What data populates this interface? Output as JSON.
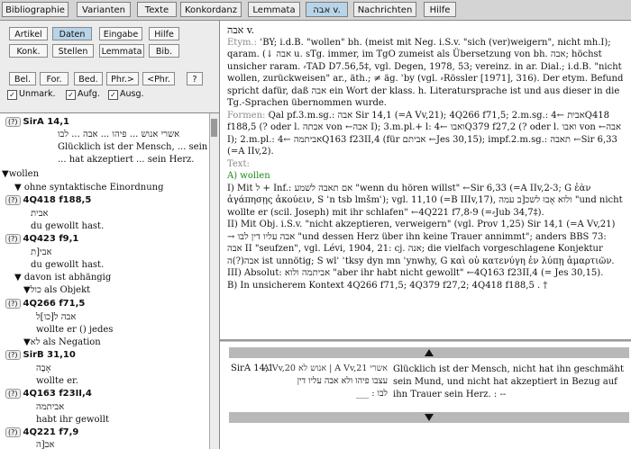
{
  "tabs": [
    "Bibliographie",
    "Varianten",
    "Texte",
    "Konkordanz",
    "Lemmata",
    "אבה v.",
    "Nachrichten",
    "Hilfe"
  ],
  "buttons": {
    "row1": [
      "Artikel",
      "Daten",
      "Eingabe",
      "Hilfe"
    ],
    "row2": [
      "Konk.",
      "Stellen",
      "Lemmata",
      "Bib."
    ],
    "row3": [
      "Bel.",
      "For.",
      "Bed.",
      "Phr.>",
      "<Phr.",
      "?"
    ],
    "checks": [
      "Unmark.",
      "Aufg.",
      "Ausg."
    ]
  },
  "tree": {
    "r1_ref": "SirA 14,1",
    "r1_heb1": "אשרי אנוש ... פיהו ... אבה ... לבו",
    "r1_de1": "Glücklich ist der Mensch, ... sein Mund,",
    "r1_de2": "... hat akzeptiert ... sein Herz.",
    "n_wollen": "▼wollen",
    "n_ohne": "▼ ohne syntaktische Einordnung",
    "r2_ref": "4Q418 f188,5",
    "r2_heb": "אבית",
    "r2_de": "du gewollt hast.",
    "r3_ref": "4Q423 f9,1",
    "r3_heb": "אבי[ת",
    "r3_de": "du gewollt hast.",
    "n_davon": "▼ davon ist abhängig",
    "n_obj": "▼כול als Objekt",
    "r4_ref": "4Q266 f71,5",
    "r4_heb": "אבה ל[כו]ל",
    "r4_de": "wollte er () jedes",
    "n_neg": "▼לא als Negation",
    "r5_ref": "SirB 31,10",
    "r5_heb": "אָבָה",
    "r5_de": "wollte er.",
    "r6_ref": "4Q163 f23II,4",
    "r6_heb": "אביתמה",
    "r6_de": "habt ihr gewollt",
    "r7_ref": "4Q221 f7,9",
    "r7_heb": "אב[ה"
  },
  "main": {
    "lemma": "אבה v.",
    "etym_label": "Etym.:",
    "etym_text": "ʾBY; i.d.B. \"wollen\" bh. (meist mit Neg. i.S.v. \"sich (ver)weigern\", nicht mh.I); qaram. (↓ אבה u. sTg. immer, im TgO zumeist als Übersetzung von bh. אבה; höchst unsicher raram. ⸗TAD D7.56,5‡, vgl. Degen, 1978, 53; vereinz. in ar. Dial.; i.d.B. \"nicht wollen, zurückweisen\" ar., äth.; ≠ äg. ʾby (vgl. ⸗Rössler [1971], 316). Der etym. Befund spricht dafür, daß אבה ein Wort der klass. h. Literatursprache ist und aus dieser in die Tg.-Sprachen übernommen wurde.",
    "formen_label": "Formen:",
    "formen_text": "Qal pf.3.m.sg.: אבה Sir 14,1 (=A Vv,21); 4Q266 f71,5; 2.m.sg.: אבית ←4Q418 f188,5 (? oder l. אבתה von ←אבה I); 3.m.pl.+ l: ואבו ←4Q379 f27,2 (? oder l. ואבו von ←אבה I); 2.m.pl.: אביתמה ←4Q163 f23II,4 (für אביתם ←Jes 30,15); impf.2.m.sg.: תאבה ←Sir 6,33 (=A IIv,2).",
    "text_label": "Text:",
    "a_label": "A) wollen",
    "i_text": "I) Mit ל + Inf.: אם תאבה לשמע \"wenn du hören willst\" ←Sir 6,33 (=A IIv,2-3; G ἐὰν ἀγάπησῃς ἀκούειν, S ʾn tsb lmšmʿ); vgl. 11,10 (=B IIIv,17), ולוא אָבוּ לשכ[ב עמה \"und nicht wollte er (scil. Joseph) mit ihr schlafen\" ←4Q221 f7,8-9 (=⸗Jub 34,7‡).",
    "ii_text": "II) Mit Obj. i.S.v. \"nicht akzeptieren, verweigern\" (vgl. Prov 1,25) Sir 14,1 (=A Vv,21) → אבה עליו דין לבו \"und dessen Herz über ihn keine Trauer annimmt\"; anders BBS 73: אבה II \"seufzen\", vgl. Lévi, 1904, 21: cj. אנה; die vielfach vorgeschlagene Konjektur אבה(?)ה ist unnötig; S wlʾ ʾtksy dyn mn ʾynwhy, G καὶ οὐ κατενύγη ἐν λύπῃ ἁμαρτιῶν.",
    "iii_text": "III) Absolut: אביתמה ולוא \"aber ihr habt nicht gewollt\" ←4Q163 f23II,4 (= Jes 30,15).",
    "b_text": "B) In unsicherem Kontext 4Q266 f71,5; 4Q379 f27,2; 4Q418 f188,5 . †"
  },
  "bottom": {
    "ref": "SirA 14,1",
    "heb1": "אשרי A Vv,21 | אנוש לא A Vv,20",
    "heb2": "עצבו פיהו ולא אבה עליו דין",
    "heb3": "לבו : ___",
    "de": "Glücklich ist der Mensch, nicht hat ihn geschmäht sein Mund, und nicht hat akzeptiert in Bezug auf ihn Trauer sein Herz. : --"
  }
}
